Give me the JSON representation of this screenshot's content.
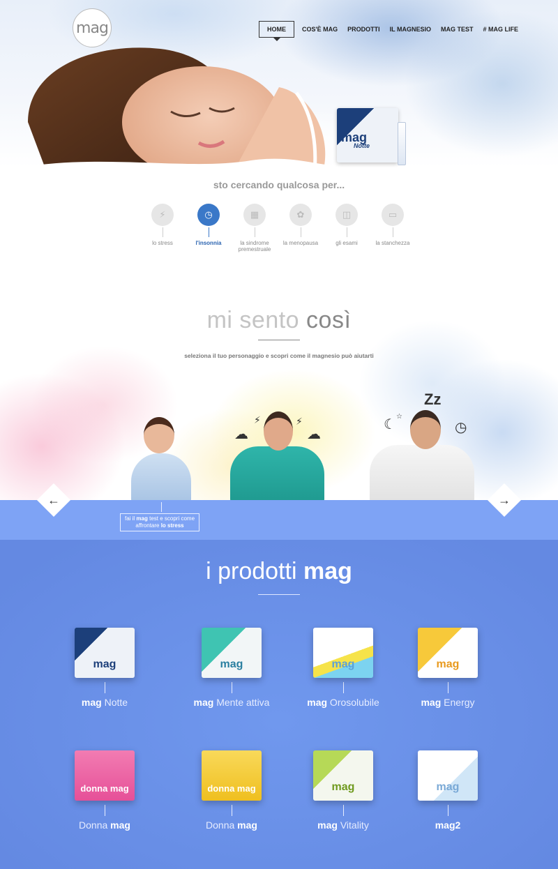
{
  "brand": {
    "logo_text": "mag"
  },
  "nav": {
    "items": [
      "HOME",
      "COS'È MAG",
      "PRODOTTI",
      "IL MAGNESIO",
      "MAG TEST",
      "# MAG LIFE"
    ]
  },
  "hero": {
    "product_pack": {
      "brand": "mag",
      "variant": "Notte"
    },
    "search_title": "sto cercando qualcosa per...",
    "categories": [
      {
        "label": "lo stress",
        "icon": "lightning-icon"
      },
      {
        "label": "l'insonnia",
        "icon": "clock-icon",
        "active": true
      },
      {
        "label": "la sindrome premestruale",
        "icon": "calendar-icon"
      },
      {
        "label": "la menopausa",
        "icon": "flower-icon"
      },
      {
        "label": "gli esami",
        "icon": "book-icon"
      },
      {
        "label": "la stanchezza",
        "icon": "monitor-icon"
      }
    ]
  },
  "mood": {
    "title_light": "mi sento ",
    "title_bold": "così",
    "subtitle": "seleziona il tuo personaggio e scopri come il magnesio può aiutarti",
    "prev_arrow": "←",
    "next_arrow": "→",
    "tip": {
      "pre": "fai il ",
      "mag": "mag",
      "mid": " test e scopri come affrontare ",
      "topic": "lo stress"
    }
  },
  "products": {
    "title_light": "i prodotti ",
    "title_bold": "mag",
    "items": [
      {
        "pack_text": "mag",
        "bold": "mag",
        "light": " Notte"
      },
      {
        "pack_text": "mag",
        "bold": "mag",
        "light": " Mente attiva"
      },
      {
        "pack_text": "mag",
        "bold": "mag",
        "light": " Orosolubile"
      },
      {
        "pack_text": "mag",
        "bold": "mag",
        "light": " Energy"
      },
      {
        "pack_text": "donna mag",
        "light": "Donna ",
        "bold": "mag"
      },
      {
        "pack_text": "donna mag",
        "light": "Donna ",
        "bold": "mag"
      },
      {
        "pack_text": "mag",
        "bold": "mag",
        "light": " Vitality"
      },
      {
        "pack_text": "mag",
        "bold": "mag2",
        "light": ""
      }
    ]
  },
  "colors": {
    "accent_blue": "#3a78c8",
    "band_blue": "#7ea3f5",
    "products_bg": "#6a8fe8"
  }
}
